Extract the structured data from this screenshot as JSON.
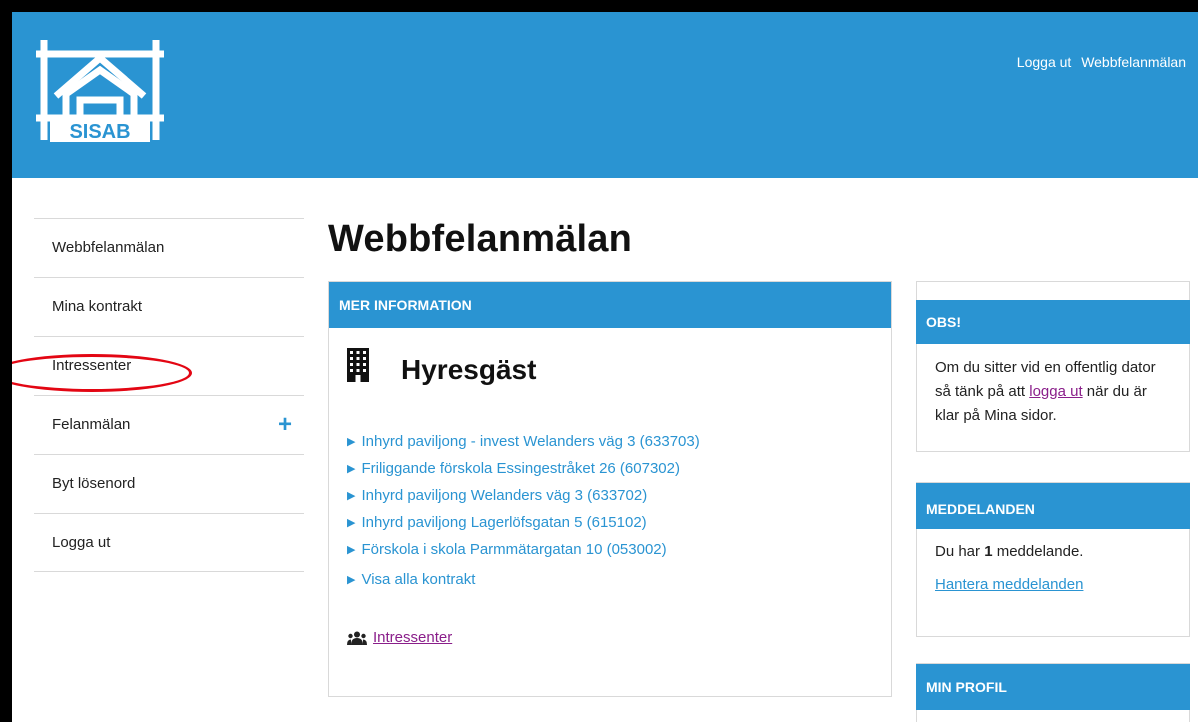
{
  "brand": {
    "logo_text": "SISAB",
    "primary_color": "#2a94d2",
    "highlight_color": "#e30613"
  },
  "header": {
    "links": [
      "Logga ut",
      "Webbfelanmälan"
    ]
  },
  "sidebar": {
    "items": [
      {
        "label": "Webbfelanmälan"
      },
      {
        "label": "Mina kontrakt"
      },
      {
        "label": "Intressenter"
      },
      {
        "label": "Felanmälan",
        "expand_icon": "+"
      },
      {
        "label": "Byt lösenord"
      },
      {
        "label": "Logga ut"
      }
    ]
  },
  "main": {
    "title": "Webbfelanmälan",
    "panel": {
      "header": "MER INFORMATION",
      "icon": "building-icon",
      "heading": "Hyresgäst",
      "contracts": [
        "Inhyrd paviljong - invest Welanders väg 3 (633703)",
        "Friliggande förskola Essingestråket 26 (607302)",
        "Inhyrd paviljong Welanders väg 3 (633702)",
        "Inhyrd paviljong Lagerlöfsgatan 5 (615102)",
        "Förskola i skola Parmmätargatan 10 (053002)"
      ],
      "show_all": "Visa alla kontrakt",
      "stakeholders_icon": "group-icon",
      "stakeholders_link": "Intressenter"
    }
  },
  "aside": {
    "obs": {
      "header": "OBS!",
      "text_before": "Om du sitter vid en offentlig dator så tänk på att",
      "link": "logga ut",
      "text_after": "när du är klar på Mina sidor."
    },
    "messages": {
      "header": "MEDDELANDEN",
      "text_before": "Du har",
      "count": "1",
      "text_after": "meddelande.",
      "link": "Hantera meddelanden"
    },
    "profile": {
      "header": "MIN PROFIL"
    }
  }
}
